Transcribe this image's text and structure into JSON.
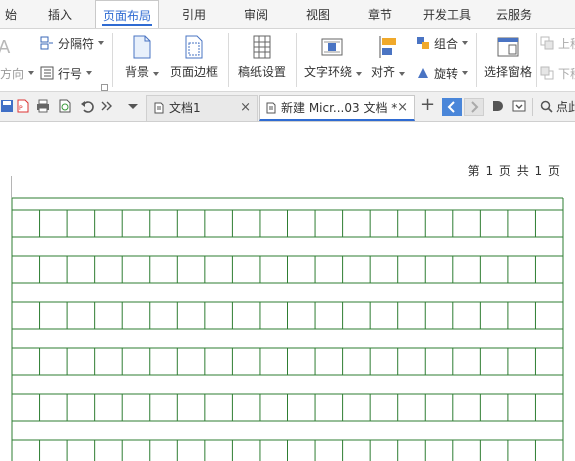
{
  "ribbon_tabs": [
    {
      "label": "始",
      "active": false
    },
    {
      "label": "插入",
      "active": false
    },
    {
      "label": "页面布局",
      "active": true
    },
    {
      "label": "引用",
      "active": false
    },
    {
      "label": "审阅",
      "active": false
    },
    {
      "label": "视图",
      "active": false
    },
    {
      "label": "章节",
      "active": false
    },
    {
      "label": "开发工具",
      "active": false
    },
    {
      "label": "云服务",
      "active": false
    }
  ],
  "ribbon": {
    "direction_label": "方向",
    "separator_label": "分隔符",
    "line_number_label": "行号",
    "background_label": "背景",
    "page_border_label": "页面边框",
    "manuscript_setting_label": "稿纸设置",
    "text_wrap_label": "文字环绕",
    "align_label": "对齐",
    "group_label": "组合",
    "rotate_label": "旋转",
    "selection_pane_label": "选择窗格",
    "bring_forward_label": "上移",
    "send_backward_label": "下移"
  },
  "toolbar": {
    "tabs": [
      {
        "label": "文档1",
        "close": "×",
        "active": false
      },
      {
        "label": "新建 Micr...03 文档 *",
        "close": "×",
        "active": true
      }
    ],
    "add_tab": "+",
    "search_label": "点此"
  },
  "document": {
    "header_text": "第 1 页 共 1 页"
  },
  "colors": {
    "accent": "#2f6bd2",
    "grid": "#2e7d32"
  }
}
